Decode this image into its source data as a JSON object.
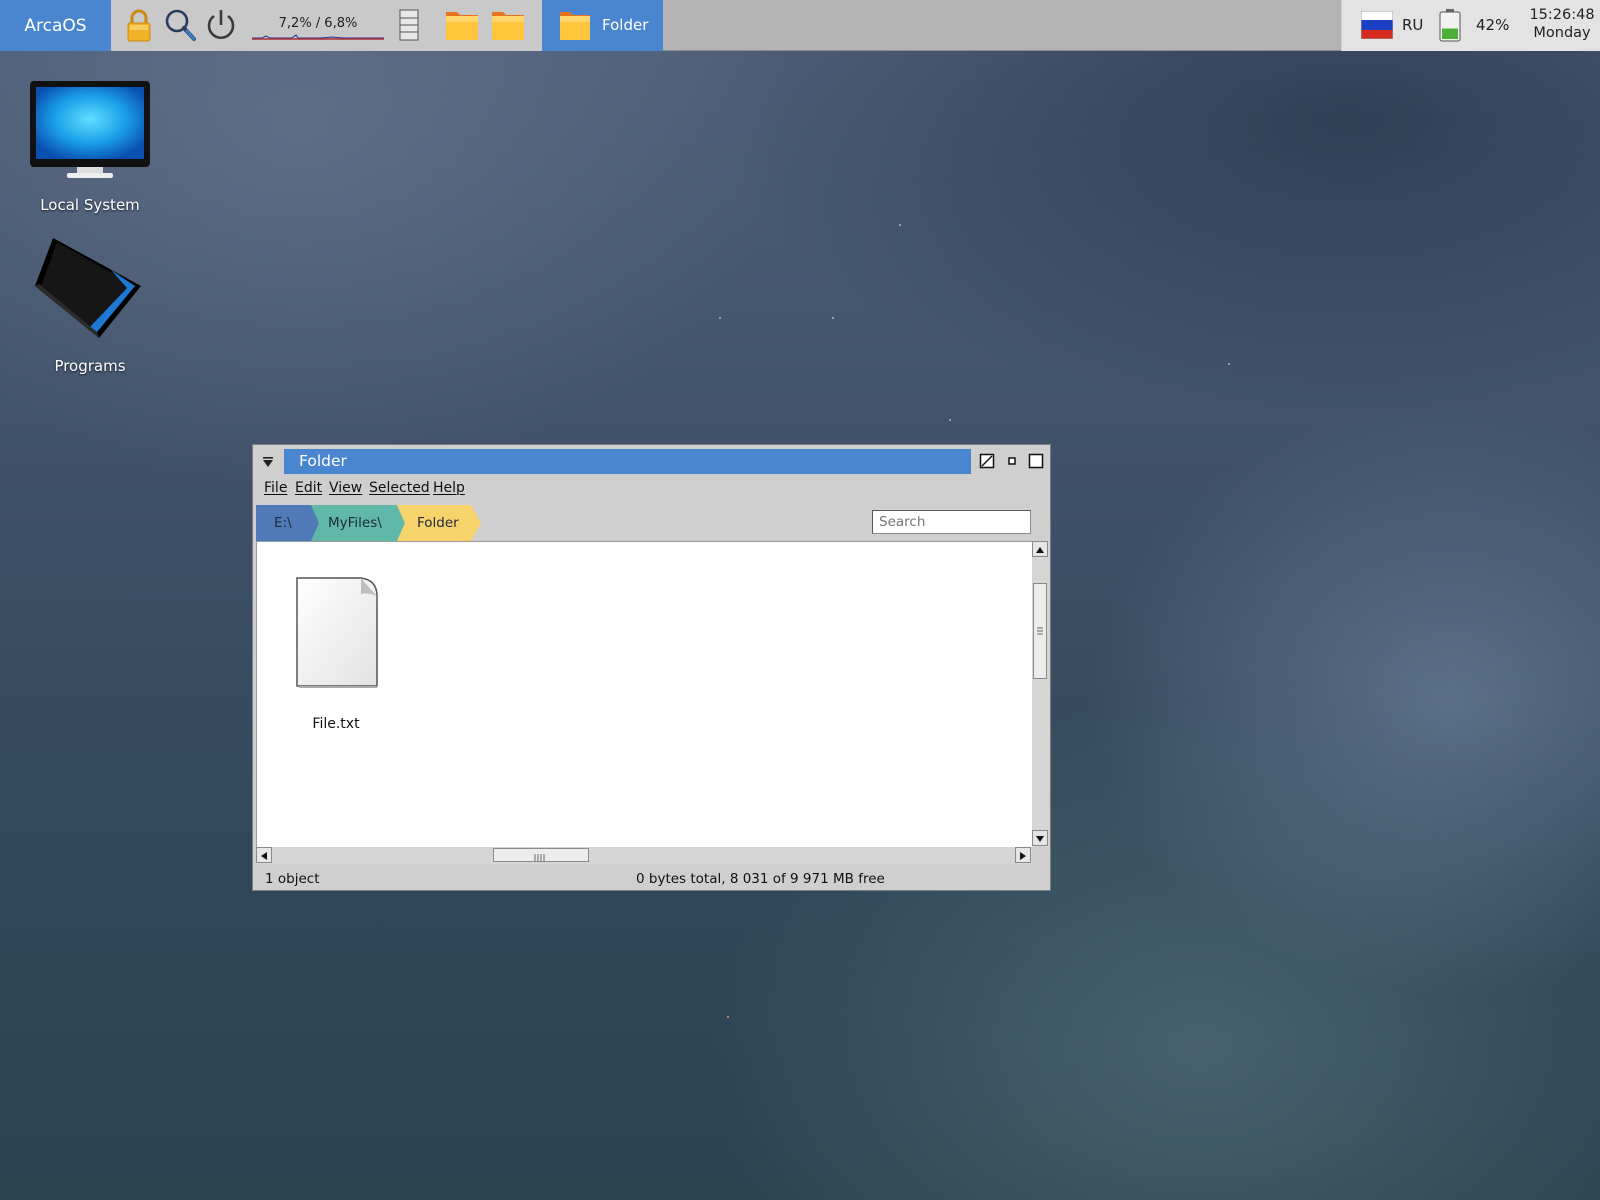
{
  "taskbar": {
    "start_label": "ArcaOS",
    "launchers": [
      {
        "icon": "lock-icon"
      },
      {
        "icon": "search-icon"
      },
      {
        "icon": "power-icon"
      }
    ],
    "cpu_monitor": {
      "text": "7,2% / 6,8%"
    },
    "quick_folders": [
      {
        "icon": "folder-icon"
      },
      {
        "icon": "folder-icon"
      }
    ],
    "active_task": {
      "label": "Folder",
      "icon": "folder-icon"
    },
    "language": {
      "code": "RU",
      "icon": "russian-flag-icon"
    },
    "battery": {
      "percent_text": "42%",
      "level": 0.42
    },
    "clock": {
      "time": "15:26:48",
      "day": "Monday"
    }
  },
  "desktop": {
    "icons": [
      {
        "label": "Local System",
        "icon": "monitor-icon"
      },
      {
        "label": "Programs",
        "icon": "programs-folder-icon"
      }
    ]
  },
  "window": {
    "title": "Folder",
    "menu": [
      {
        "label": "File"
      },
      {
        "label": "Edit"
      },
      {
        "label": "View"
      },
      {
        "label": "Selected"
      },
      {
        "label": "Help"
      }
    ],
    "breadcrumb": [
      {
        "label": "E:\\",
        "color": "#4f79b7"
      },
      {
        "label": "MyFiles\\",
        "color": "#5fb8a8"
      },
      {
        "label": "Folder",
        "color": "#f7d36b"
      }
    ],
    "search_placeholder": "Search",
    "files": [
      {
        "name": "File.txt",
        "icon": "text-file-icon"
      }
    ],
    "status": {
      "count": "1 object",
      "summary": "0 bytes total, 8 031 of 9 971 MB free"
    }
  },
  "colors": {
    "accent": "#4a86cf",
    "taskbar": "#b4b4b4",
    "window_frame": "#cfcfcf"
  }
}
